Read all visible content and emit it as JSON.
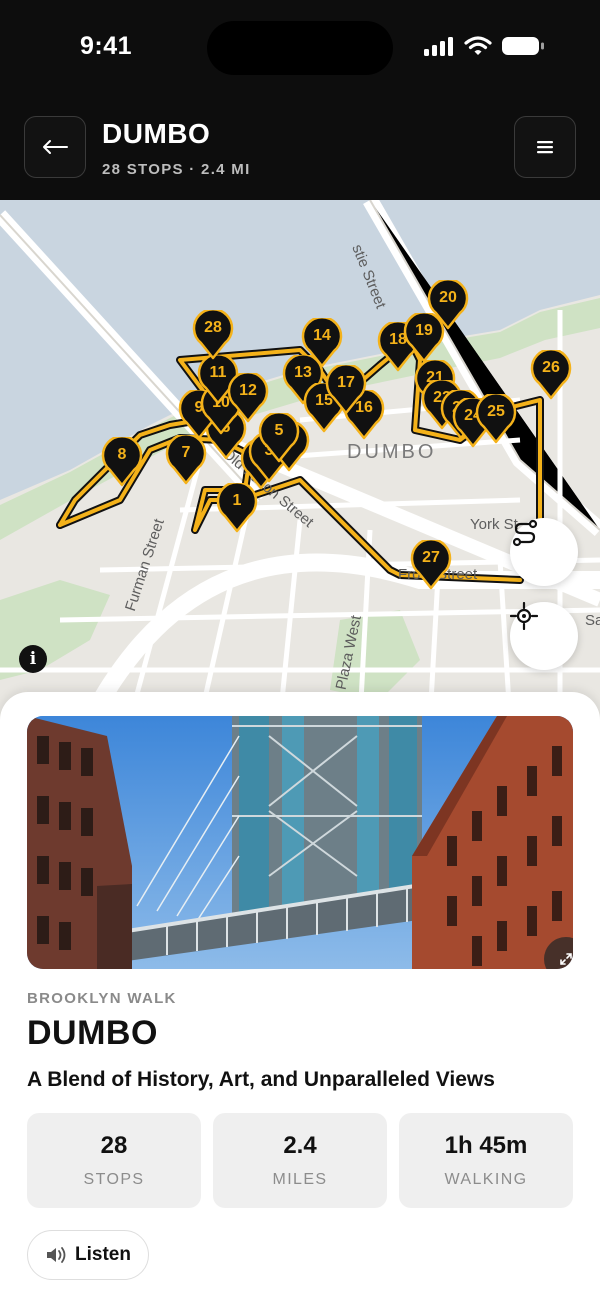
{
  "status_bar": {
    "time": "9:41",
    "signal_icon": "cellular-signal-icon",
    "wifi_icon": "wifi-icon",
    "battery_icon": "battery-icon"
  },
  "header": {
    "back_icon": "arrow-left-icon",
    "title": "DUMBO",
    "subtitle": "28 STOPS · 2.4 MI",
    "menu_icon": "hamburger-menu-icon"
  },
  "map": {
    "area_label": "DUMBO",
    "street_labels": [
      "stie Street",
      "Furman Street",
      "Old Fulton Street",
      "York St",
      "Front Street",
      "n Plaza West",
      "Sa"
    ],
    "stops": [
      "1",
      "2",
      "3",
      "4",
      "5",
      "6",
      "7",
      "8",
      "9",
      "10",
      "11",
      "12",
      "13",
      "14",
      "15",
      "16",
      "17",
      "18",
      "19",
      "20",
      "21",
      "22",
      "23",
      "24",
      "25",
      "26",
      "27",
      "28"
    ],
    "route_button_icon": "route-icon",
    "locate_button_icon": "locate-crosshair-icon",
    "info_icon": "info-icon",
    "colors": {
      "route": "#f4b21a",
      "pin": "#111111",
      "water": "#c9d5e0",
      "park": "#cfe2c4"
    }
  },
  "sheet": {
    "photo_alt": "Manhattan Bridge between brick buildings",
    "expand_icon": "expand-icon",
    "eyebrow": "BROOKLYN WALK",
    "title": "DUMBO",
    "subtitle": "A Blend of History, Art, and Unparalleled Views",
    "stats": [
      {
        "value": "28",
        "label": "STOPS"
      },
      {
        "value": "2.4",
        "label": "MILES"
      },
      {
        "value": "1h 45m",
        "label": "WALKING"
      }
    ],
    "listen_icon": "speaker-icon",
    "listen_label": "Listen"
  }
}
